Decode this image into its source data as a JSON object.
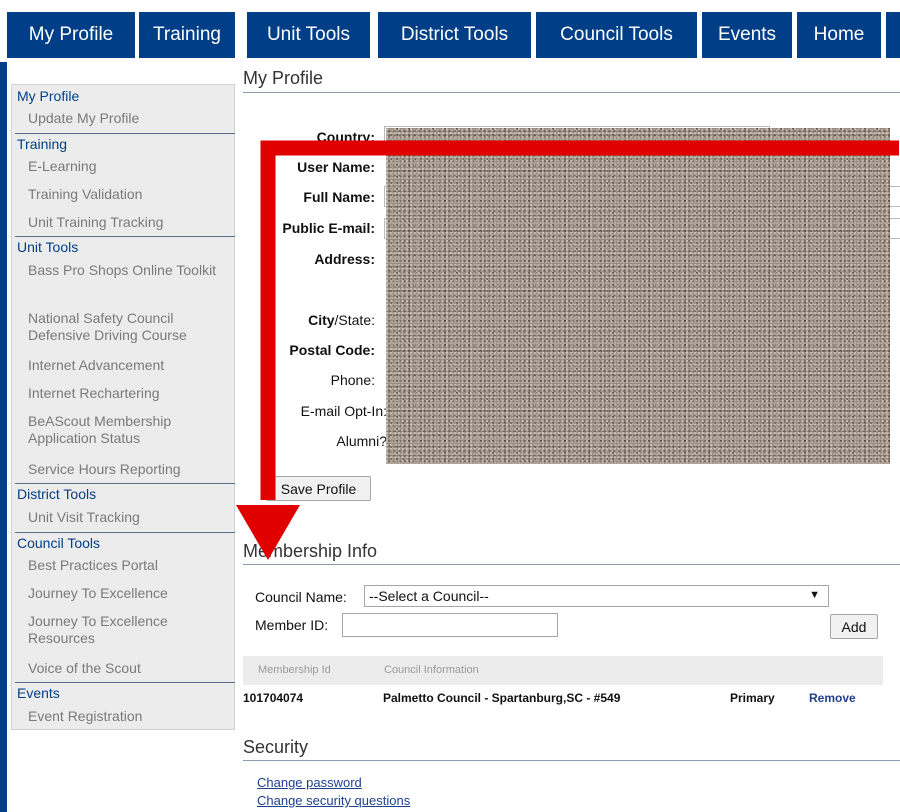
{
  "nav": {
    "tabs": [
      {
        "label": "My Profile"
      },
      {
        "label": "Training"
      },
      {
        "label": "Unit Tools"
      },
      {
        "label": "District Tools"
      },
      {
        "label": "Council Tools"
      },
      {
        "label": "Events"
      },
      {
        "label": "Home"
      }
    ]
  },
  "sidebar": {
    "sections": [
      {
        "title": "My Profile",
        "items": [
          "Update My Profile"
        ]
      },
      {
        "title": "Training",
        "items": [
          "E-Learning",
          "Training Validation",
          "Unit Training Tracking"
        ]
      },
      {
        "title": "Unit Tools",
        "items": [
          "Bass Pro Shops Online Toolkit",
          "National Safety Council Defensive Driving Course",
          "Internet Advancement",
          "Internet Rechartering",
          "BeAScout Membership Application Status",
          "Service Hours Reporting"
        ]
      },
      {
        "title": "District Tools",
        "items": [
          "Unit Visit Tracking"
        ]
      },
      {
        "title": "Council Tools",
        "items": [
          "Best Practices Portal",
          "Journey To Excellence",
          "Journey To Excellence Resources",
          "Voice of the Scout"
        ]
      },
      {
        "title": "Events",
        "items": [
          "Event Registration"
        ]
      }
    ]
  },
  "profile": {
    "title": "My Profile",
    "fields": {
      "country": "Country:",
      "username": "User Name:",
      "fullname": "Full Name:",
      "email": "Public E-mail:",
      "address": "Address:",
      "citystate_city": "City",
      "citystate_rest": "/State:",
      "postal": "Postal Code:",
      "phone": "Phone:",
      "optin": "E-mail Opt-In:",
      "alumni": "Alumni?"
    },
    "save_label": "Save Profile"
  },
  "membership": {
    "title": "Membership Info",
    "council_label": "Council Name:",
    "council_selected": "--Select a Council--",
    "member_id_label": "Member ID:",
    "member_id_value": "",
    "add_label": "Add",
    "table": {
      "headers": [
        "Membership Id",
        "Council Information"
      ],
      "rows": [
        {
          "id": "101704074",
          "council": "Palmetto Council - Spartanburg,SC - #549",
          "type": "Primary",
          "action": "Remove"
        }
      ]
    }
  },
  "security": {
    "title": "Security",
    "links": [
      "Change password",
      "Change security questions"
    ]
  },
  "colors": {
    "brand_blue": "#003f87",
    "arrow_red": "#e00000",
    "link_blue": "#1f3f8f"
  },
  "icons": {
    "dropdown": "chevron-down-icon",
    "annotation": "red-arrow-icon"
  }
}
